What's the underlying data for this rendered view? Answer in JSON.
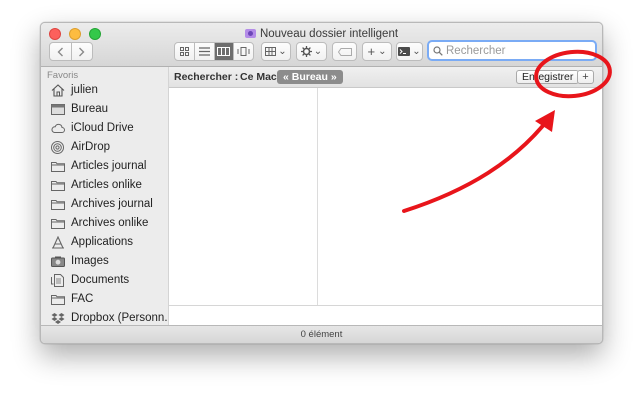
{
  "window": {
    "title": "Nouveau dossier intelligent",
    "title_icon": "smart-folder-icon"
  },
  "toolbar": {
    "back_icon": "chevron-left-icon",
    "forward_icon": "chevron-right-icon",
    "view_modes": [
      "icon-view-icon",
      "list-view-icon",
      "column-view-icon",
      "cover-flow-icon"
    ],
    "active_view": "column-view-icon",
    "arrange_icon": "grid-arrange-icon",
    "action_icon": "gear-icon",
    "tag_icon": "tag-icon",
    "plus_label": "+",
    "terminal_icon": "terminal-icon",
    "dropdown_glyph": "⌄"
  },
  "search": {
    "placeholder": "Rechercher",
    "value": ""
  },
  "sidebar": {
    "header": "Favoris",
    "items": [
      {
        "label": "julien",
        "icon": "home-icon"
      },
      {
        "label": "Bureau",
        "icon": "desktop-icon"
      },
      {
        "label": "iCloud Drive",
        "icon": "cloud-icon"
      },
      {
        "label": "AirDrop",
        "icon": "airdrop-icon"
      },
      {
        "label": "Articles journal",
        "icon": "folder-icon"
      },
      {
        "label": "Articles onlike",
        "icon": "folder-icon"
      },
      {
        "label": "Archives journal",
        "icon": "folder-icon"
      },
      {
        "label": "Archives onlike",
        "icon": "folder-icon"
      },
      {
        "label": "Applications",
        "icon": "applications-icon"
      },
      {
        "label": "Images",
        "icon": "camera-icon"
      },
      {
        "label": "Documents",
        "icon": "documents-icon"
      },
      {
        "label": "FAC",
        "icon": "folder-icon"
      },
      {
        "label": "Dropbox (Personn...",
        "icon": "dropbox-icon"
      }
    ]
  },
  "scopebar": {
    "label": "Rechercher :",
    "scope_mac": "Ce Mac",
    "scope_selected": "« Bureau »",
    "save_label": "Enregistrer",
    "add_label": "+"
  },
  "status": {
    "text": "0 élément"
  },
  "colors": {
    "annotation_red": "#e8151b",
    "search_focus": "#7aabf5",
    "close": "#fc605c",
    "minimize": "#fdbc40",
    "zoom": "#34c84a"
  }
}
